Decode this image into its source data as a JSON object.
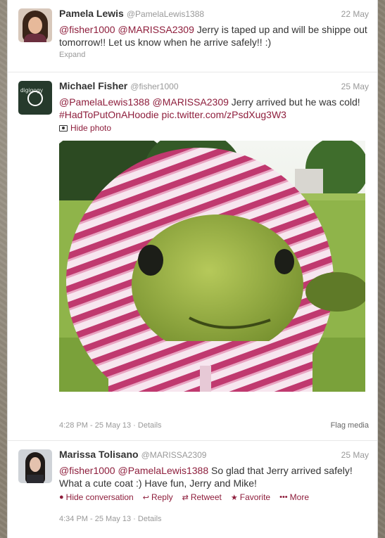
{
  "tweets": [
    {
      "fullname": "Pamela Lewis",
      "username": "@PamelaLewis1388",
      "time": "22 May",
      "mention1": "@fisher1000",
      "mention2": "@MARISSA2309",
      "body": "Jerry is taped up and will be shippe out tomorrow!! Let us know when he arrive safely!! :)",
      "expand": "Expand"
    },
    {
      "fullname": "Michael Fisher",
      "username": "@fisher1000",
      "time": "25 May",
      "mention1": "@PamelaLewis1388",
      "mention2": "@MARISSA2309",
      "body": "Jerry arrived but he was cold!",
      "hashtag": "#HadToPutOnAHoodie",
      "piclink": "pic.twitter.com/zPsdXug3W3",
      "hide_photo": "Hide photo",
      "timestamp": "4:28 PM - 25 May 13",
      "details": "Details",
      "flag_media": "Flag media",
      "avatar_text": "digigogy"
    },
    {
      "fullname": "Marissa Tolisano",
      "username": "@MARISSA2309",
      "time": "25 May",
      "mention1": "@fisher1000",
      "mention2": "@PamelaLewis1388",
      "body": "So glad that Jerry arrived safely! What a cute coat :) Have fun, Jerry and Mike!",
      "actions": {
        "hide_conversation": "Hide conversation",
        "reply": "Reply",
        "retweet": "Retweet",
        "favorite": "Favorite",
        "more": "More"
      },
      "timestamp": "4:34 PM - 25 May 13",
      "details": "Details"
    }
  ],
  "colors": {
    "link": "#8e1e3c",
    "muted": "#999999",
    "text": "#333333"
  }
}
